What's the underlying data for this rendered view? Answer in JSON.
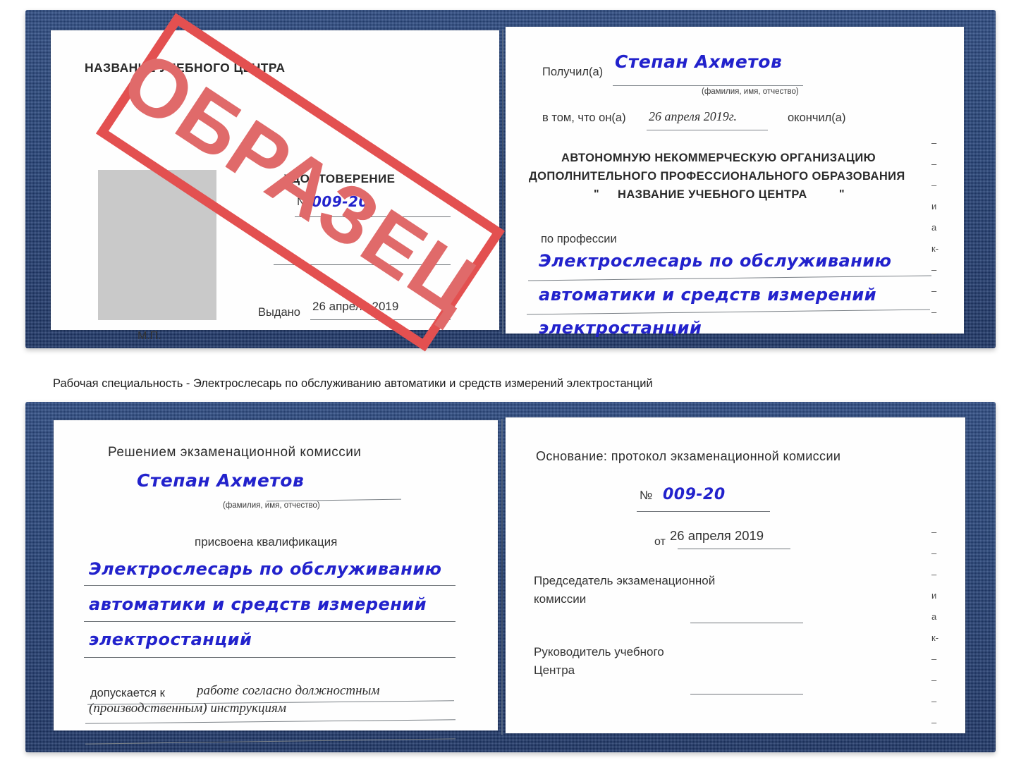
{
  "document": {
    "type": "certificate-scan",
    "stamp_text": "ОБРАЗЕЦ",
    "stamp_color": "#e35050"
  },
  "caption": {
    "text": "Рабочая специальность - Электрослесарь по обслуживанию автоматики и средств измерений электростанций"
  },
  "cert_top": {
    "left_page": {
      "center_title": "НАЗВАНИЕ УЧЕБНОГО ЦЕНТРА",
      "doc_kind": "УДОСТОВЕРЕНИЕ",
      "number_label": "№",
      "number_value": "009-20",
      "issued_label": "Выдано",
      "issued_value": "26 апреля 2019",
      "seal_label": "М.П."
    },
    "right_page": {
      "received_label": "Получил(а)",
      "received_value": "Степан Ахметов",
      "name_hint": "(фамилия, имя, отчество)",
      "that_he_label": "в том, что он(а)",
      "that_he_value": "26 апреля 2019г.",
      "finished_label": "окончил(а)",
      "org_line1": "АВТОНОМНУЮ НЕКОММЕРЧЕСКУЮ ОРГАНИЗАЦИЮ",
      "org_line2": "ДОПОЛНИТЕЛЬНОГО ПРОФЕССИОНАЛЬНОГО ОБРАЗОВАНИЯ",
      "org_line3_quote_open": "\"",
      "org_line3": "НАЗВАНИЕ УЧЕБНОГО ЦЕНТРА",
      "org_line3_quote_close": "\"",
      "profession_label": "по профессии",
      "profession_line1": "Электрослесарь по обслуживанию",
      "profession_line2": "автоматики и средств измерений",
      "profession_line3": "электростанций",
      "edge_fragments": [
        "–",
        "–",
        "–",
        "и",
        "а",
        "к-",
        "–",
        "–",
        "–",
        "–"
      ]
    }
  },
  "cert_bottom": {
    "left_page": {
      "decision_title": "Решением экзаменационной комиссии",
      "name_value": "Степан Ахметов",
      "name_hint": "(фамилия, имя, отчество)",
      "qualification_label": "присвоена квалификация",
      "qualification_line1": "Электрослесарь по обслуживанию",
      "qualification_line2": "автоматики и средств измерений",
      "qualification_line3": "электростанций",
      "admitted_label": "допускается к",
      "admitted_value_line1": "работе согласно должностным",
      "admitted_value_line2": "(производственным) инструкциям"
    },
    "right_page": {
      "basis_label": "Основание: протокол экзаменационной комиссии",
      "number_label": "№",
      "number_value": "009-20",
      "date_label": "от",
      "date_value": "26 апреля 2019",
      "chairman_line1": "Председатель экзаменационной",
      "chairman_line2": "комиссии",
      "head_line1": "Руководитель учебного",
      "head_line2": "Центра",
      "edge_fragments": [
        "–",
        "–",
        "–",
        "и",
        "а",
        "к-",
        "–",
        "–",
        "–",
        "–"
      ]
    }
  }
}
